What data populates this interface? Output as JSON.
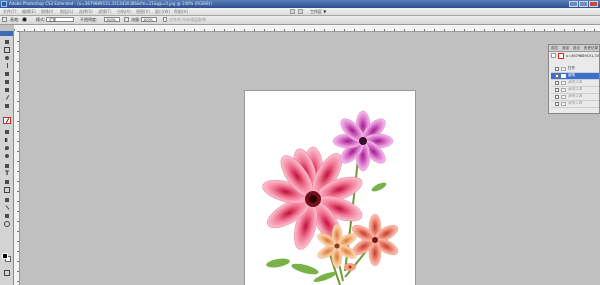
{
  "window": {
    "title": "Adobe Photoshop CS3 Extended - [u=3679889151,3313430386&fm=21&gp=0.jpg @ 100% (RGB/8)]"
  },
  "menu": {
    "items": [
      "文件(F)",
      "编辑(E)",
      "图像(I)",
      "图层(L)",
      "选择(S)",
      "滤镜(T)",
      "分析(A)",
      "视图(V)",
      "窗口(W)",
      "帮助(H)"
    ],
    "workspace_label": "工作区 ▼"
  },
  "options": {
    "brush_label": "画笔:",
    "mode_label": "模式:",
    "mode_value": "正常",
    "opacity_label": "不透明度:",
    "opacity_value": "100%",
    "flow_label": "流量:",
    "flow_value": "100%",
    "checkbox_label": "对齐的  所有图层取样"
  },
  "panel": {
    "tabs": [
      "图层",
      "通道",
      "路径",
      "历史记录"
    ],
    "history_source": "u=3679889151,33",
    "history_items": [
      "打开",
      "画笔",
      "画笔工具",
      "画笔工具",
      "画笔工具",
      "画笔工具"
    ]
  },
  "colors": {
    "accent_selection": "#3a6fd0",
    "tool_highlight": "#e0261a",
    "foreground": "#000000",
    "background": "#ffffff"
  },
  "tools": [
    "move-icon",
    "marquee-icon",
    "lasso-icon",
    "magic-wand-icon",
    "crop-icon",
    "slice-icon",
    "healing-icon",
    "brush-icon",
    "clone-stamp-icon",
    "history-brush-icon",
    "eraser-icon",
    "gradient-icon",
    "blur-icon",
    "dodge-icon",
    "pen-icon",
    "type-icon",
    "path-select-icon",
    "shape-icon",
    "notes-icon",
    "eyedropper-icon",
    "hand-icon",
    "zoom-icon"
  ],
  "selected_tool": "history-brush-icon"
}
